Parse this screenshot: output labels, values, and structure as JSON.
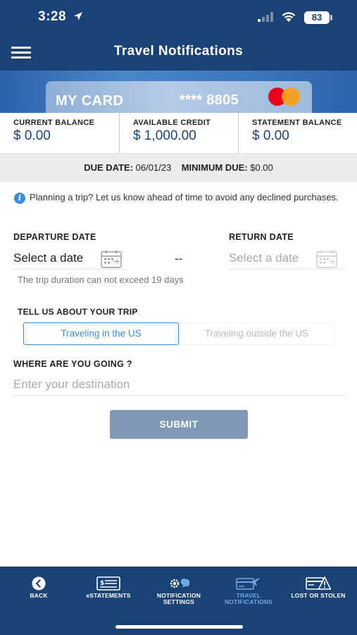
{
  "status_bar": {
    "time": "3:28",
    "battery": "83"
  },
  "header": {
    "title": "Travel Notifications"
  },
  "card": {
    "name": "MY CARD",
    "number": "**** 8805"
  },
  "balances": [
    {
      "label": "CURRENT BALANCE",
      "value": "$ 0.00"
    },
    {
      "label": "AVAILABLE CREDIT",
      "value": "$ 1,000.00"
    },
    {
      "label": "STATEMENT BALANCE",
      "value": "$ 0.00"
    }
  ],
  "due": {
    "due_label": "DUE DATE:",
    "due_value": "06/01/23",
    "min_label": "MINIMUM DUE:",
    "min_value": "$0.00"
  },
  "info": {
    "text": "Planning a trip? Let us know ahead of time to avoid any declined purchases."
  },
  "form": {
    "departure_label": "DEPARTURE DATE",
    "departure_placeholder": "Select a date",
    "separator": "--",
    "return_label": "RETURN DATE",
    "return_placeholder": "Select a date",
    "helper": "The trip duration can not exceed 19 days",
    "trip_label": "TELL US ABOUT YOUR TRIP",
    "option_us": "Traveling in the US",
    "option_outside": "Traveling outside the US",
    "destination_label": "WHERE ARE YOU GOING ?",
    "destination_placeholder": "Enter your destination",
    "submit": "SUBMIT"
  },
  "tabs": [
    {
      "label": "BACK",
      "icon": "back-icon",
      "active": false
    },
    {
      "label": "eSTATEMENTS",
      "icon": "statement-icon",
      "active": false
    },
    {
      "label": "NOTIFICATION\nSETTINGS",
      "icon": "notification-settings-icon",
      "active": false
    },
    {
      "label": "TRAVEL\nNOTIFICATIONS",
      "icon": "travel-icon",
      "active": true
    },
    {
      "label": "LOST OR STOLEN",
      "icon": "lost-stolen-icon",
      "active": false
    }
  ],
  "colors": {
    "brand": "#1a4275",
    "accent": "#3a8fd8",
    "submit_disabled": "#8099b4",
    "active_tab": "#6ea7e6"
  }
}
